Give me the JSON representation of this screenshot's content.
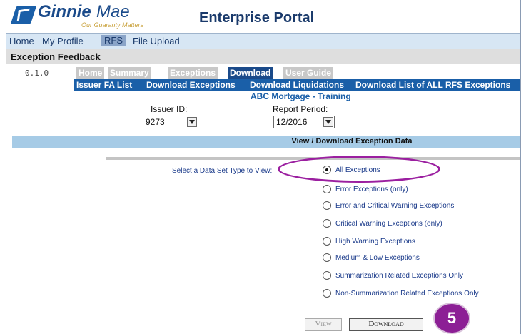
{
  "header": {
    "logo_ginnie": "Ginnie",
    "logo_mae": "Mae",
    "logo_tagline": "Our Guaranty Matters",
    "portal_title": "Enterprise Portal"
  },
  "nav": {
    "items": [
      "Home",
      "My Profile",
      "RFS",
      "File Upload"
    ],
    "active": "RFS"
  },
  "section_title": "Exception Feedback",
  "version": "0.1.0",
  "tabs": [
    "Home",
    "Summary",
    "Exceptions",
    "Download",
    "User Guide"
  ],
  "active_tab": "Download",
  "subnav": [
    "Issuer FA List",
    "Download Exceptions",
    "Download Liquidations",
    "Download List of ALL RFS Exceptions"
  ],
  "issuer_name": "ABC Mortgage - Training",
  "issuer_id": {
    "label": "Issuer ID:",
    "value": "9273"
  },
  "report_period": {
    "label": "Report Period:",
    "value": "12/2016"
  },
  "view_header": "View / Download Exception Data",
  "select_type_label": "Select a Data Set Type to View:",
  "options": [
    {
      "label": "All Exceptions",
      "checked": true
    },
    {
      "label": "Error Exceptions (only)",
      "checked": false
    },
    {
      "label": "Error and Critical Warning Exceptions",
      "checked": false
    },
    {
      "label": "Critical Warning Exceptions (only)",
      "checked": false
    },
    {
      "label": "High Warning Exceptions",
      "checked": false
    },
    {
      "label": "Medium & Low Exceptions",
      "checked": false
    },
    {
      "label": "Summarization Related Exceptions Only",
      "checked": false
    },
    {
      "label": "Non-Summarization Related Exceptions Only",
      "checked": false
    }
  ],
  "buttons": {
    "view": "View",
    "download": "Download"
  },
  "step_number": "5",
  "colors": {
    "brand_blue": "#1a5fa8",
    "highlight": "#9b1fa0",
    "header_band": "#a6cbe6"
  }
}
